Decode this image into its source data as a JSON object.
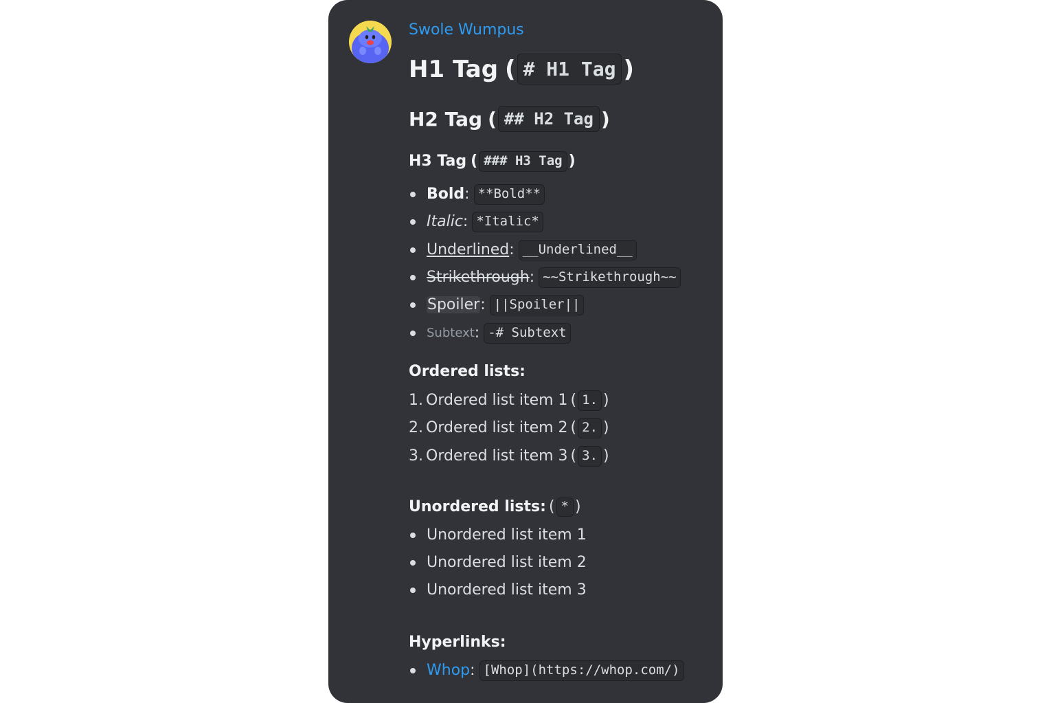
{
  "message": {
    "username": "Swole Wumpus",
    "username_color": "#2f9bf0",
    "avatar_icon": "wumpus-avatar",
    "headings": {
      "h1": {
        "text": "H1 Tag",
        "open": "(",
        "code": "# H1 Tag",
        "close": ")"
      },
      "h2": {
        "text": "H2 Tag",
        "open": "(",
        "code": "## H2 Tag",
        "close": ")"
      },
      "h3": {
        "text": "H3 Tag",
        "open": "(",
        "code": "### H3 Tag",
        "close": ")"
      }
    },
    "formatting": [
      {
        "label": "Bold",
        "sep": ":",
        "code": "**Bold**"
      },
      {
        "label": "Italic",
        "sep": ":",
        "code": "*Italic*"
      },
      {
        "label": "Underlined",
        "sep": ":",
        "code": "__Underlined__"
      },
      {
        "label": "Strikethrough",
        "sep": ":",
        "code": "~~Strikethrough~~"
      },
      {
        "label": "Spoiler",
        "sep": ":",
        "code": "||Spoiler||"
      },
      {
        "label": "Subtext",
        "sep": ":",
        "code": "-# Subtext"
      }
    ],
    "ordered": {
      "title": "Ordered lists:",
      "items": [
        {
          "num": "1.",
          "text": "Ordered list item 1",
          "open": "(",
          "code": "1.",
          "close": ")"
        },
        {
          "num": "2.",
          "text": "Ordered list item 2",
          "open": "(",
          "code": "2.",
          "close": ")"
        },
        {
          "num": "3.",
          "text": "Ordered list item 3",
          "open": "(",
          "code": "3.",
          "close": ")"
        }
      ]
    },
    "unordered": {
      "title": "Unordered lists:",
      "open": "(",
      "code": "*",
      "close": ")",
      "items": [
        "Unordered list item 1",
        "Unordered list item 2",
        "Unordered list item 3"
      ]
    },
    "hyperlinks": {
      "title": "Hyperlinks:",
      "link_text": "Whop",
      "sep": ":",
      "code": "[Whop](https://whop.com/)"
    }
  }
}
